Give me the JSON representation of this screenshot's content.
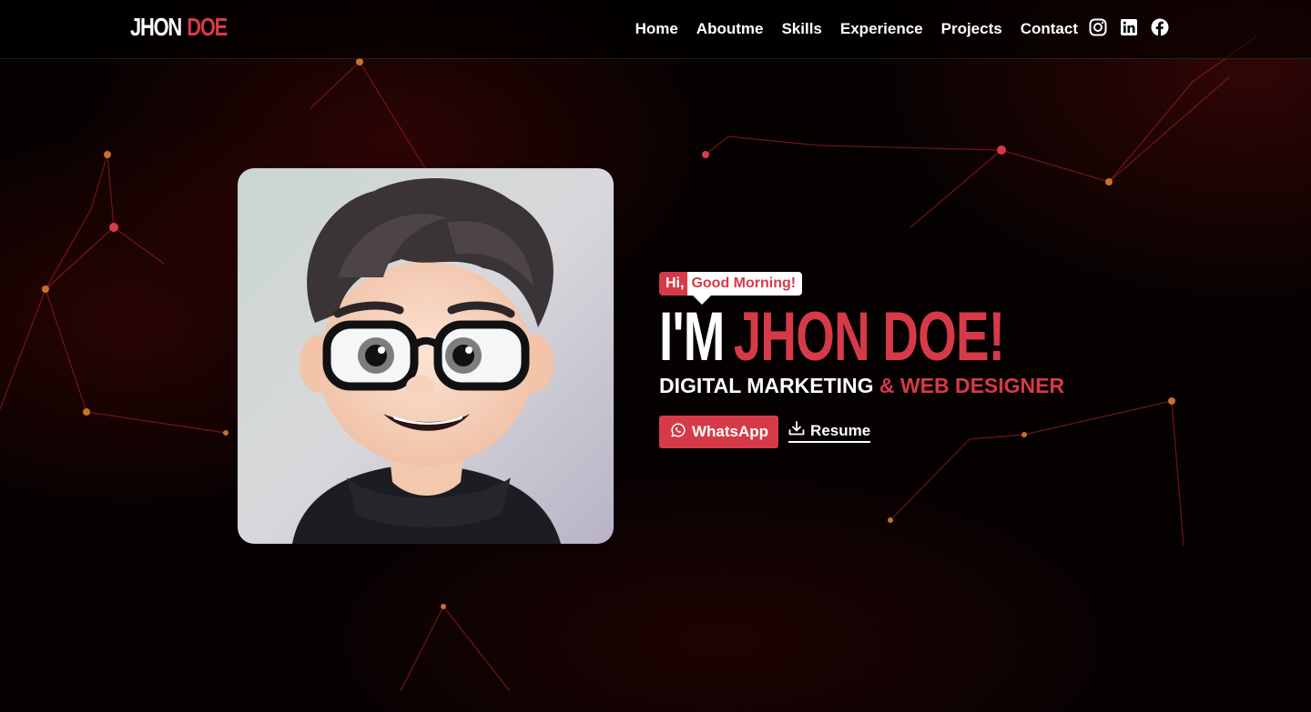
{
  "header": {
    "logo_first": "JHON",
    "logo_second": "DOE",
    "nav": [
      "Home",
      "Aboutme",
      "Skills",
      "Experience",
      "Projects",
      "Contact"
    ],
    "socials": [
      "instagram-icon",
      "linkedin-icon",
      "facebook-icon"
    ]
  },
  "hero": {
    "greeting_hi": "Hi,",
    "greeting_msg": "Good Morning!",
    "title_first": "I'M",
    "title_second": "JHON DOE!",
    "subtitle_first": "DIGITAL MARKETING",
    "subtitle_second": "& WEB DESIGNER",
    "whatsapp_label": "WhatsApp",
    "resume_label": "Resume"
  },
  "colors": {
    "accent": "#d63a48",
    "background": "#000000",
    "text": "#ffffff"
  }
}
